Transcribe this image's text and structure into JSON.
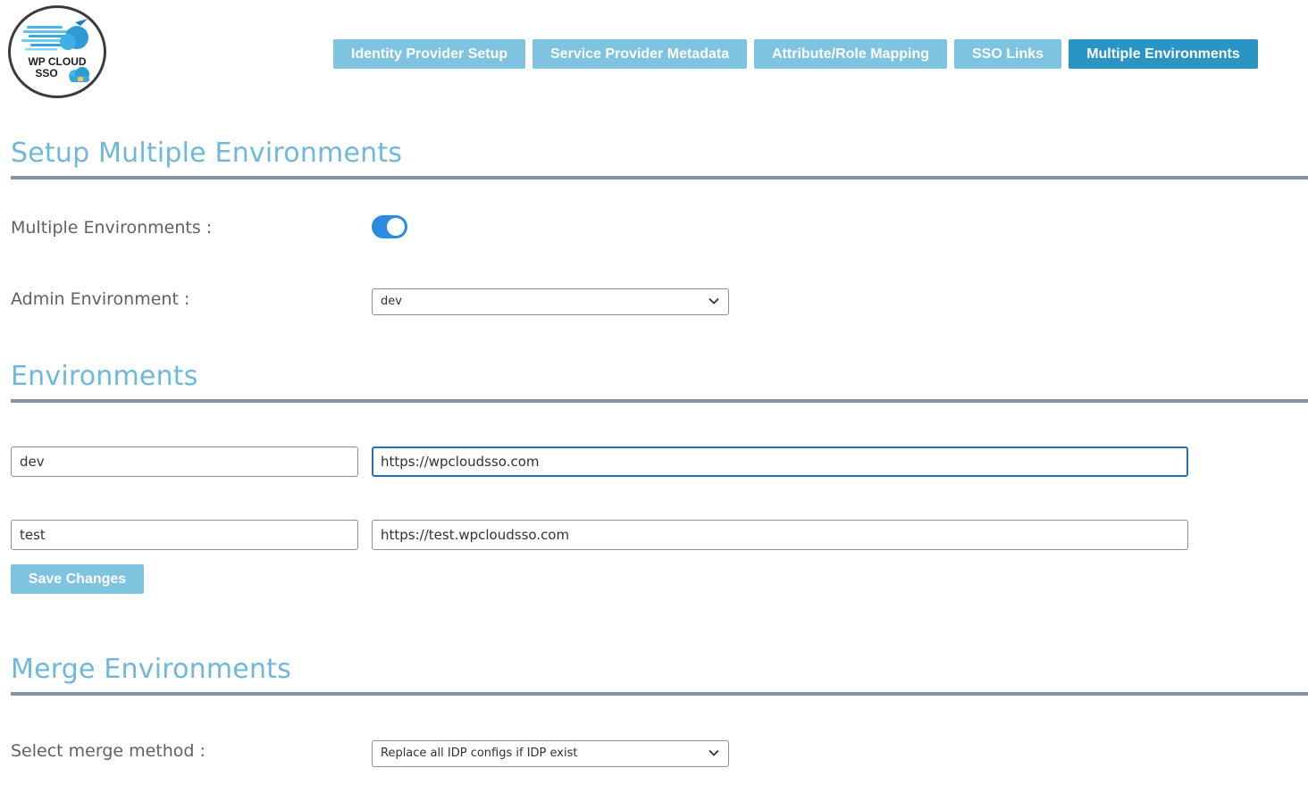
{
  "logo": {
    "line1": "WP CLOUD",
    "line2": "SSO"
  },
  "tabs": [
    {
      "label": "Identity Provider Setup",
      "active": false
    },
    {
      "label": "Service Provider Metadata",
      "active": false
    },
    {
      "label": "Attribute/Role Mapping",
      "active": false
    },
    {
      "label": "SSO Links",
      "active": false
    },
    {
      "label": "Multiple Environments",
      "active": true
    }
  ],
  "setup": {
    "title": "Setup Multiple Environments",
    "multiple_label": "Multiple Environments :",
    "multiple_enabled": true,
    "admin_label": "Admin Environment :",
    "admin_value": "dev"
  },
  "environments": {
    "title": "Environments",
    "rows": [
      {
        "name": "dev",
        "url": "https://wpcloudsso.com"
      },
      {
        "name": "test",
        "url": "https://test.wpcloudsso.com"
      }
    ],
    "save_label": "Save Changes"
  },
  "merge": {
    "title": "Merge Environments",
    "method_label": "Select merge method :",
    "method_value": "Replace all IDP configs if IDP exist"
  },
  "colors": {
    "accent": "#7ec3e0",
    "accent_active": "#2a95c5",
    "heading": "#6fb8dc",
    "rule": "#8390a8",
    "toggle_on": "#2a8ce0"
  }
}
